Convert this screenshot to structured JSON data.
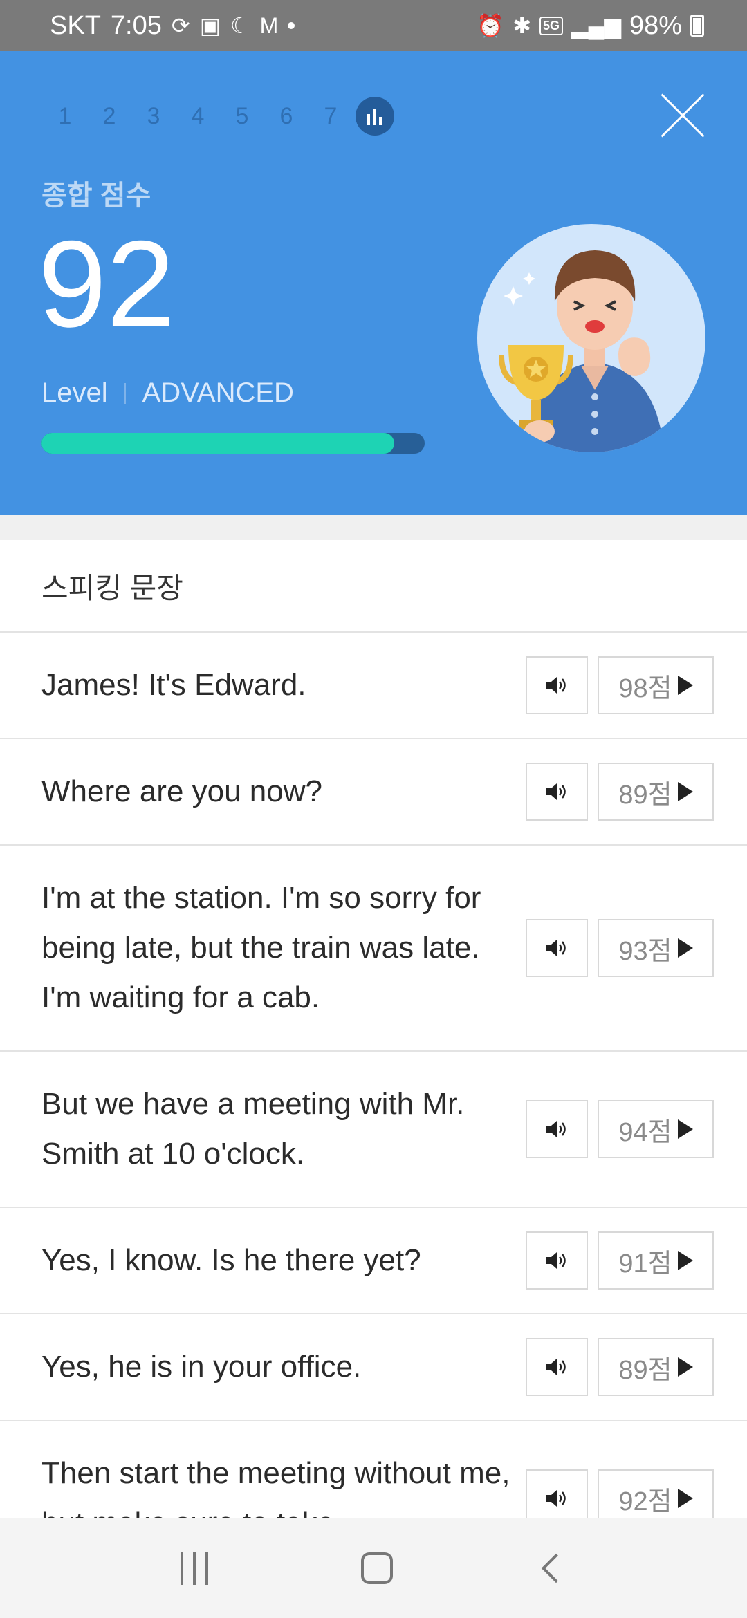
{
  "status": {
    "carrier": "SKT",
    "time": "7:05",
    "battery": "98%",
    "network_badge": "5G"
  },
  "header": {
    "steps": [
      "1",
      "2",
      "3",
      "4",
      "5",
      "6",
      "7"
    ],
    "score_label": "종합 점수",
    "score": "92",
    "level_label": "Level",
    "level_value": "ADVANCED",
    "progress_percent": 92,
    "colors": {
      "background": "#4392e2",
      "progress_fill": "#1ed3b4",
      "progress_track": "#275f97"
    }
  },
  "section_title": "스피킹 문장",
  "sentences": [
    {
      "text": "James! It's Edward.",
      "score": "98점"
    },
    {
      "text": "Where are you now?",
      "score": "89점"
    },
    {
      "text": "I'm at the station. I'm so sorry for being late, but the train was late. I'm waiting for a cab.",
      "score": "93점"
    },
    {
      "text": "But we have a meeting with Mr. Smith at 10 o'clock.",
      "score": "94점"
    },
    {
      "text": "Yes, I know. Is he there yet?",
      "score": "91점"
    },
    {
      "text": "Yes, he is in your office.",
      "score": "89점"
    },
    {
      "text": "Then start the meeting without me, but make sure to take",
      "score": "92점"
    }
  ],
  "highlight_colors": {
    "error": "#e53935",
    "warning": "#f0a020"
  }
}
